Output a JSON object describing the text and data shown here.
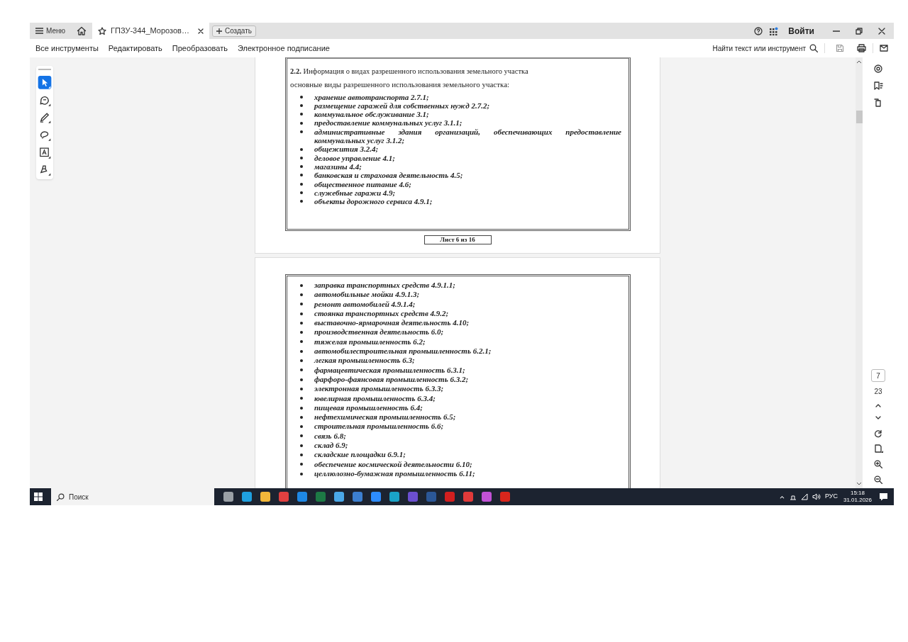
{
  "tab_bar": {
    "menu": "Меню",
    "tab": {
      "title": "ГПЗУ-344_Морозов…",
      "selected": true
    },
    "create_button": "Создать",
    "sign_in": "Войти"
  },
  "toolbar": {
    "menu": [
      "Все инструменты",
      "Редактировать",
      "Преобразовать",
      "Электронное подписание"
    ],
    "search": "Найти текст или инструмент"
  },
  "left_tools": [
    {
      "kind": "select",
      "selected": true
    },
    {
      "kind": "comment",
      "selected": false
    },
    {
      "kind": "pen",
      "selected": false
    },
    {
      "kind": "lasso",
      "selected": false
    },
    {
      "kind": "textbox",
      "selected": false
    },
    {
      "kind": "stamp",
      "selected": false
    }
  ],
  "page_1": {
    "heading": "**2.2.** Информация о видах разрешенного использования земельного участка",
    "subheading": "основные виды разрешенного использования земельного участка:",
    "items": [
      "хранение автотранспорта 2.7.1;",
      "размещение гаражей для собственных нужд 2.7.2;",
      "коммунальное обслуживание 3.1;",
      "предоставление коммунальных услуг 3.1.1;",
      "административные здания организаций, обеспечивающих предоставление коммунальных услуг 3.1.2;",
      "общежития 3.2.4;",
      "деловое управление 4.1;",
      "магазины 4.4;",
      "банковская и страховая деятельность 4.5;",
      "общественное питание 4.6;",
      "служебные гаражи 4.9;",
      "объекты дорожного сервиса 4.9.1;"
    ],
    "sheet_label": "Лист 6 из 16"
  },
  "page_2": {
    "items": [
      "заправка транспортных средств 4.9.1.1;",
      "автомобильные мойки 4.9.1.3;",
      "ремонт автомобилей 4.9.1.4;",
      "стоянка транспортных средств 4.9.2;",
      "выставочно-ярмарочная деятельность 4.10;",
      "производственная деятельность 6.0;",
      "тяжелая промышленность 6.2;",
      "автомобилестроительная промышленность 6.2.1;",
      "легкая промышленность 6.3;",
      "фармацевтическая промышленность 6.3.1;",
      "фарфоро-фаянсовая промышленность 6.3.2;",
      "электронная промышленность 6.3.3;",
      "ювелирная промышленность 6.3.4;",
      "пищевая промышленность 6.4;",
      "нефтехимическая промышленность 6.5;",
      "строительная промышленность 6.6;",
      "связь 6.8;",
      "склад 6.9;",
      "складские площадки 6.9.1;",
      "обеспечение космической деятельности 6.10;",
      "целлюлозно-бумажная промышленность 6.11;"
    ]
  },
  "right_rail": {
    "current_page": "7",
    "total_pages": "23"
  },
  "taskbar": {
    "search": "Поиск",
    "language": "РУС",
    "time": "15:18",
    "date": "31.01.2026"
  }
}
